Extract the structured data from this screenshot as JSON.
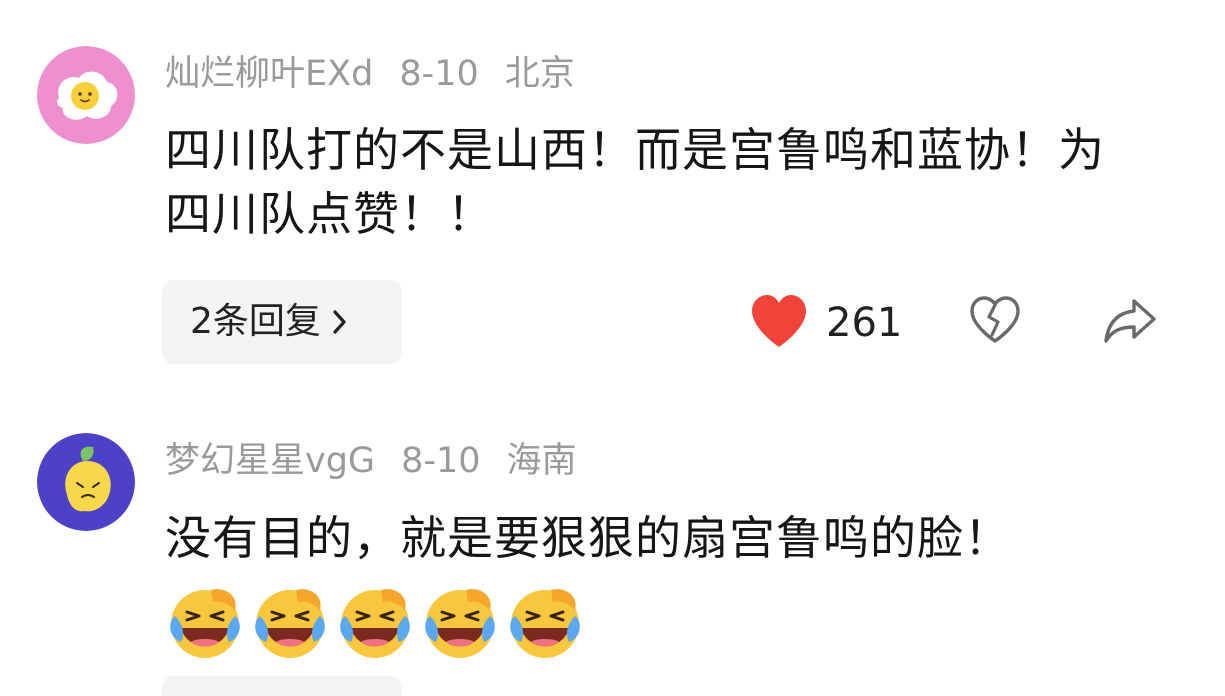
{
  "comments": [
    {
      "username": "灿烂柳叶EXd",
      "date": "8-10",
      "location": "北京",
      "text": "四川队打的不是山西！而是宫鲁鸣和蓝协！为四川队点赞！！",
      "reply_label": "2条回复",
      "likes": "261",
      "avatar_icon": "fried-egg-avatar",
      "like_color": "#f0433a"
    },
    {
      "username": "梦幻星星vgG",
      "date": "8-10",
      "location": "海南",
      "text": "没有目的，就是要狠狠的扇宫鲁鸣的脸！",
      "emoji_icon": "rolling-laughing-emoji",
      "emoji_count": 5,
      "avatar_icon": "lemon-avatar"
    }
  ]
}
